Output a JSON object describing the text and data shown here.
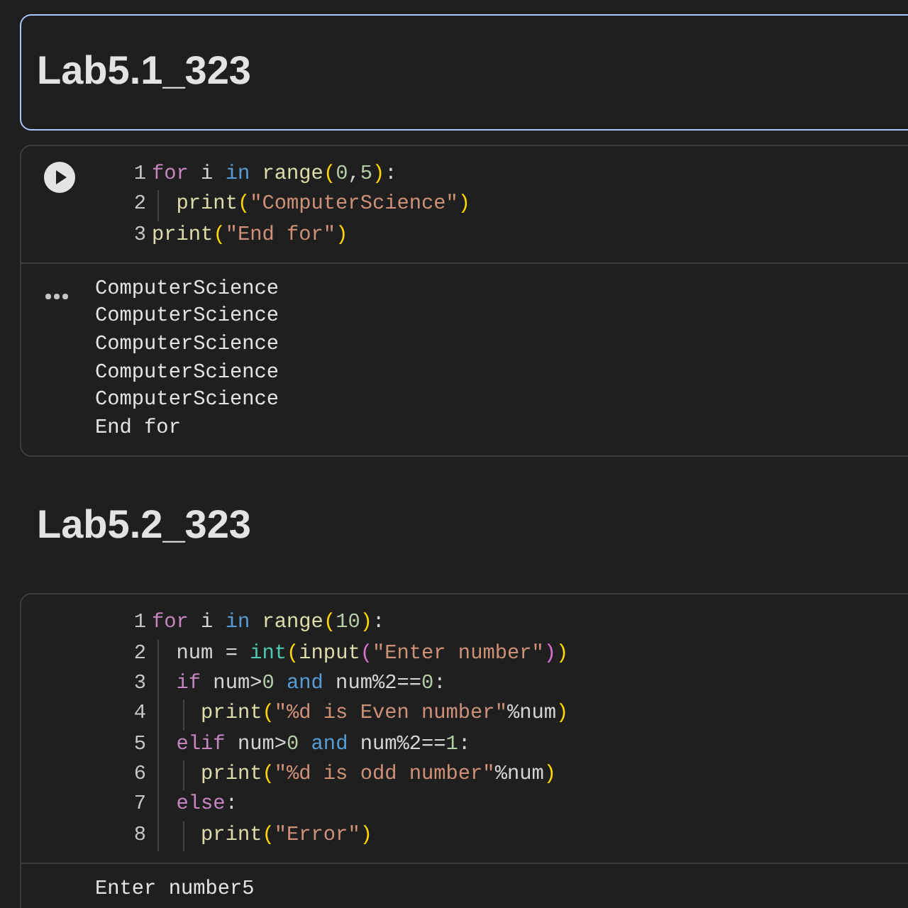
{
  "cells": [
    {
      "kind": "markdown",
      "heading": "Lab5.1_323",
      "selected": true
    },
    {
      "kind": "code",
      "run_button": true,
      "lines": [
        {
          "number": "1",
          "tokens": [
            {
              "t": "for",
              "color": "#c586c0"
            },
            {
              "t": " i ",
              "color": "#d4d4d4"
            },
            {
              "t": "in",
              "color": "#569cd6"
            },
            {
              "t": " range",
              "color": "#dcdcaa"
            },
            {
              "t": "(",
              "color": "#ffd700"
            },
            {
              "t": "0",
              "color": "#b5cea8"
            },
            {
              "t": ",",
              "color": "#d4d4d4"
            },
            {
              "t": "5",
              "color": "#b5cea8"
            },
            {
              "t": ")",
              "color": "#ffd700"
            },
            {
              "t": ":",
              "color": "#d4d4d4"
            }
          ]
        },
        {
          "number": "2",
          "tokens": [
            {
              "t": "  print",
              "color": "#dcdcaa"
            },
            {
              "t": "(",
              "color": "#ffd700"
            },
            {
              "t": "\"ComputerScience\"",
              "color": "#ce9178"
            },
            {
              "t": ")",
              "color": "#ffd700"
            }
          ]
        },
        {
          "number": "3",
          "tokens": [
            {
              "t": "print",
              "color": "#dcdcaa"
            },
            {
              "t": "(",
              "color": "#ffd700"
            },
            {
              "t": "\"End for\"",
              "color": "#ce9178"
            },
            {
              "t": ")",
              "color": "#ffd700"
            }
          ]
        }
      ],
      "output": [
        "ComputerScience",
        "ComputerScience",
        "ComputerScience",
        "ComputerScience",
        "ComputerScience",
        "End for"
      ]
    },
    {
      "kind": "markdown",
      "heading": "Lab5.2_323",
      "selected": false
    },
    {
      "kind": "code",
      "run_button": false,
      "lines": [
        {
          "number": "1",
          "tokens": [
            {
              "t": "for",
              "color": "#c586c0"
            },
            {
              "t": " i ",
              "color": "#d4d4d4"
            },
            {
              "t": "in",
              "color": "#569cd6"
            },
            {
              "t": " range",
              "color": "#dcdcaa"
            },
            {
              "t": "(",
              "color": "#ffd700"
            },
            {
              "t": "10",
              "color": "#b5cea8"
            },
            {
              "t": ")",
              "color": "#ffd700"
            },
            {
              "t": ":",
              "color": "#d4d4d4"
            }
          ]
        },
        {
          "number": "2",
          "tokens": [
            {
              "t": "  num = ",
              "color": "#d4d4d4"
            },
            {
              "t": "int",
              "color": "#4ec9b0"
            },
            {
              "t": "(",
              "color": "#ffd700"
            },
            {
              "t": "input",
              "color": "#dcdcaa"
            },
            {
              "t": "(",
              "color": "#da70d6"
            },
            {
              "t": "\"Enter number\"",
              "color": "#ce9178"
            },
            {
              "t": ")",
              "color": "#da70d6"
            },
            {
              "t": ")",
              "color": "#ffd700"
            }
          ]
        },
        {
          "number": "3",
          "tokens": [
            {
              "t": "  if",
              "color": "#c586c0"
            },
            {
              "t": " num>",
              "color": "#d4d4d4"
            },
            {
              "t": "0",
              "color": "#b5cea8"
            },
            {
              "t": " and",
              "color": "#569cd6"
            },
            {
              "t": " num%2==",
              "color": "#d4d4d4"
            },
            {
              "t": "0",
              "color": "#b5cea8"
            },
            {
              "t": ":",
              "color": "#d4d4d4"
            }
          ]
        },
        {
          "number": "4",
          "tokens": [
            {
              "t": "    print",
              "color": "#dcdcaa"
            },
            {
              "t": "(",
              "color": "#ffd700"
            },
            {
              "t": "\"%d is Even number\"",
              "color": "#ce9178"
            },
            {
              "t": "%num",
              "color": "#d4d4d4"
            },
            {
              "t": ")",
              "color": "#ffd700"
            }
          ]
        },
        {
          "number": "5",
          "tokens": [
            {
              "t": "  elif",
              "color": "#c586c0"
            },
            {
              "t": " num>",
              "color": "#d4d4d4"
            },
            {
              "t": "0",
              "color": "#b5cea8"
            },
            {
              "t": " and",
              "color": "#569cd6"
            },
            {
              "t": " num%2==",
              "color": "#d4d4d4"
            },
            {
              "t": "1",
              "color": "#b5cea8"
            },
            {
              "t": ":",
              "color": "#d4d4d4"
            }
          ]
        },
        {
          "number": "6",
          "tokens": [
            {
              "t": "    print",
              "color": "#dcdcaa"
            },
            {
              "t": "(",
              "color": "#ffd700"
            },
            {
              "t": "\"%d is odd number\"",
              "color": "#ce9178"
            },
            {
              "t": "%num",
              "color": "#d4d4d4"
            },
            {
              "t": ")",
              "color": "#ffd700"
            }
          ]
        },
        {
          "number": "7",
          "tokens": [
            {
              "t": "  else",
              "color": "#c586c0"
            },
            {
              "t": ":",
              "color": "#d4d4d4"
            }
          ]
        },
        {
          "number": "8",
          "tokens": [
            {
              "t": "    print",
              "color": "#dcdcaa"
            },
            {
              "t": "(",
              "color": "#ffd700"
            },
            {
              "t": "\"Error\"",
              "color": "#ce9178"
            },
            {
              "t": ")",
              "color": "#ffd700"
            }
          ]
        }
      ],
      "output": [
        "Enter number5"
      ]
    }
  ]
}
